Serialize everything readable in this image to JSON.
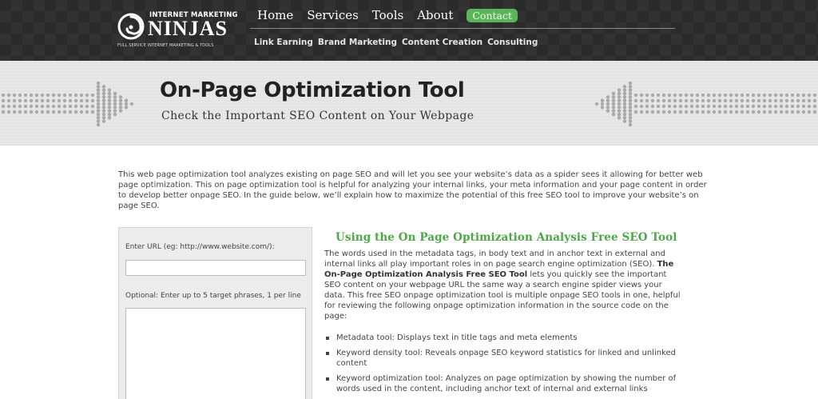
{
  "logo": {
    "top_text": "INTERNET MARKETING",
    "main_text": "NINJAS",
    "sub_text": "FULL SERVICE INTERNET MARKETING & TOOLS"
  },
  "nav": {
    "items": [
      {
        "label": "Home"
      },
      {
        "label": "Services"
      },
      {
        "label": "Tools"
      },
      {
        "label": "About"
      }
    ],
    "contact_label": "Contact"
  },
  "subnav": {
    "items": [
      {
        "label": "Link Earning"
      },
      {
        "label": "Brand Marketing"
      },
      {
        "label": "Content Creation"
      },
      {
        "label": "Consulting"
      }
    ]
  },
  "banner": {
    "title": "On-Page Optimization Tool",
    "subtitle": "Check the Important SEO Content on Your Webpage"
  },
  "intro": "This web page optimization tool analyzes existing on page SEO and will let you see your website’s data as a spider sees it allowing for better web page optimization. This on page optimization tool is helpful for analyzing your internal links, your meta information and your page content in order to develop better onpage SEO. In the guide below, we’ll explain how to maximize the potential of this free SEO tool to improve your website’s on page SEO.",
  "form": {
    "url_label": "Enter URL (eg: http://www.website.com/):",
    "url_value": "",
    "phrases_label": "Optional: Enter up to 5 target phrases, 1 per line",
    "phrases_value": ""
  },
  "article": {
    "heading": "Using the On Page Optimization Analysis Free SEO Tool",
    "body_part1": "The words used in the metadata tags, in body text and in anchor text in external and internal links all play important roles in on page search engine optimization (SEO). ",
    "body_bold": "The On-Page Optimization Analysis Free SEO Tool",
    "body_part2": " lets you quickly see the important SEO content on your webpage URL the same way a search engine spider views your data. This free SEO onpage optimization tool is multiple onpage SEO tools in one, helpful for reviewing the following onpage optimization information in the source code on the page:",
    "features": [
      "Metadata tool: Displays text in title tags and meta elements",
      "Keyword density tool: Reveals onpage SEO keyword statistics for linked and unlinked content",
      "Keyword optimization tool: Analyzes on page optimization by showing the number of words used in the content, including anchor text of internal and external links"
    ]
  },
  "colors": {
    "header_bg": "#2b2b2b",
    "contact_green": "#5cb45a",
    "heading_green": "#4aa845",
    "banner_bg": "#e7e7e7"
  }
}
